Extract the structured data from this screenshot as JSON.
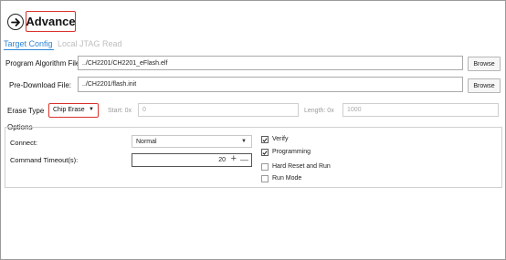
{
  "header": {
    "title": "Advance",
    "back_icon": "arrow-right-circle-icon"
  },
  "tabs": [
    {
      "label": "Target Config",
      "active": true
    },
    {
      "label": "Local JTAG",
      "active": false
    },
    {
      "label": "Read",
      "active": false
    }
  ],
  "program_algorithm": {
    "label": "Program Algorithm File :",
    "value": "../CH2201/CH2201_eFlash.elf",
    "browse_label": "Browse"
  },
  "pre_download": {
    "label": "Pre-Download File:",
    "value": "../CH2201/flash.init",
    "browse_label": "Browse"
  },
  "erase": {
    "label": "Erase Type",
    "selected": "Chip Erase",
    "start_label": "Start: 0x",
    "start_value": "0",
    "length_label": "Length: 0x",
    "length_value": "1000"
  },
  "options": {
    "title": "Options",
    "connect_label": "Connect:",
    "connect_value": "Normal",
    "timeout_label": "Command Timeout(s):",
    "timeout_value": "20",
    "plus": "+",
    "minus": "—",
    "checkboxes": [
      {
        "label": "Verify",
        "checked": true
      },
      {
        "label": "Programming",
        "checked": true
      },
      {
        "label": "Hard Reset and Run",
        "checked": false
      },
      {
        "label": "Run Mode",
        "checked": false
      }
    ]
  },
  "colors": {
    "accent": "#2f86d4",
    "highlight_border": "#d9332b"
  }
}
